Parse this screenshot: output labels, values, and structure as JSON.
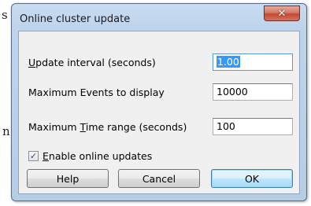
{
  "background": {
    "chars": [
      "s",
      "n"
    ]
  },
  "window": {
    "title": "Online cluster update",
    "close_glyph": "✕"
  },
  "fields": [
    {
      "label_mnemonic": "U",
      "label_rest": "pdate interval (seconds)",
      "value": "1.00",
      "selected": true
    },
    {
      "label_prefix": "Maximum Events to display",
      "value": "10000"
    },
    {
      "label_prefix": "Maximum ",
      "label_mnemonic": "T",
      "label_rest": "ime range (seconds)",
      "value": "100"
    }
  ],
  "checkbox": {
    "checked": true,
    "check_glyph": "✓",
    "label_mnemonic": "E",
    "label_rest": "nable online updates"
  },
  "buttons": {
    "help": "Help",
    "cancel": "Cancel",
    "ok": "OK"
  }
}
